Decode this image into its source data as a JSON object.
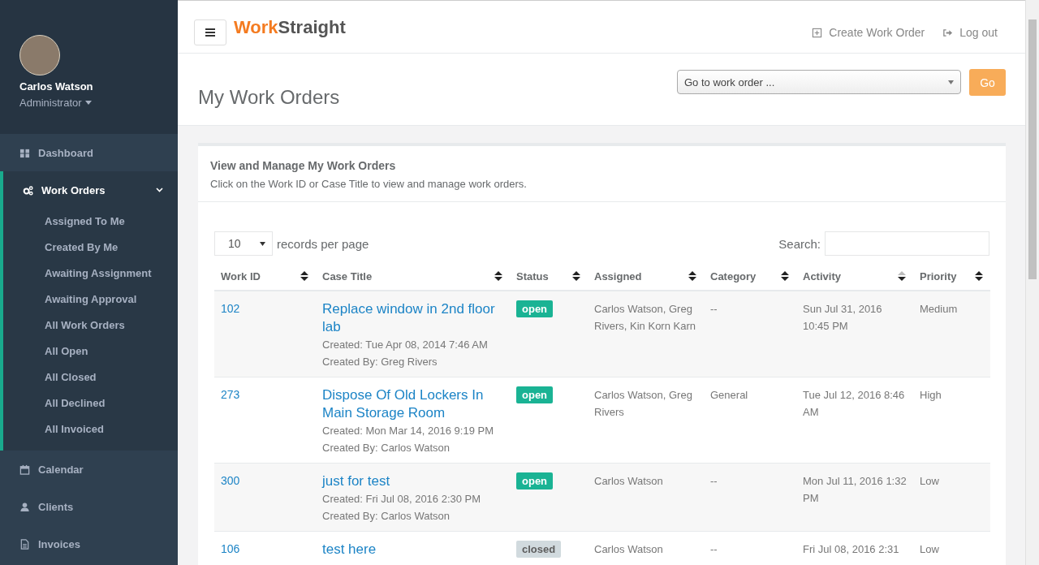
{
  "sidebar": {
    "user": {
      "name": "Carlos Watson",
      "role": "Administrator"
    },
    "items": [
      {
        "label": "Dashboard",
        "expanded": false
      },
      {
        "label": "Work Orders",
        "expanded": true,
        "children": [
          {
            "label": "Assigned To Me"
          },
          {
            "label": "Created By Me"
          },
          {
            "label": "Awaiting Assignment"
          },
          {
            "label": "Awaiting Approval"
          },
          {
            "label": "All Work Orders"
          },
          {
            "label": "All Open"
          },
          {
            "label": "All Closed"
          },
          {
            "label": "All Declined"
          },
          {
            "label": "All Invoiced"
          }
        ]
      },
      {
        "label": "Calendar",
        "expanded": false
      },
      {
        "label": "Clients",
        "expanded": false
      },
      {
        "label": "Invoices",
        "expanded": false
      }
    ]
  },
  "header": {
    "logo_first": "Work",
    "logo_second": "Straight",
    "links": [
      {
        "label": "Create Work Order"
      },
      {
        "label": "Log out"
      }
    ]
  },
  "page": {
    "title": "My Work Orders",
    "goto_placeholder": "Go to work order ...",
    "go_button": "Go"
  },
  "card": {
    "title": "View and Manage My Work Orders",
    "subtitle": "Click on the Work ID or Case Title to view and manage work orders.",
    "page_size": "10",
    "page_size_label": "records per page",
    "search_label": "Search:",
    "columns": [
      {
        "label": "Work ID",
        "sorted": false
      },
      {
        "label": "Case Title",
        "sorted": false
      },
      {
        "label": "Status",
        "sorted": false
      },
      {
        "label": "Assigned",
        "sorted": false
      },
      {
        "label": "Category",
        "sorted": false
      },
      {
        "label": "Activity",
        "sorted": true
      },
      {
        "label": "Priority",
        "sorted": false
      }
    ],
    "rows": [
      {
        "id": "102",
        "title": "Replace window in 2nd floor lab",
        "created": "Created:  Tue Apr 08, 2014 7:46 AM",
        "created_by": "Created By:  Greg Rivers",
        "status": {
          "text": "open",
          "color": "#1ab394"
        },
        "assigned": "Carlos Watson,  Greg Rivers,  Kin Korn Karn",
        "category": "--",
        "activity": "Sun Jul 31, 2016 10:45 PM",
        "priority": "Medium"
      },
      {
        "id": "273",
        "title": "Dispose Of Old Lockers In Main Storage Room",
        "created": "Created:  Mon Mar 14, 2016 9:19 PM",
        "created_by": "Created By:  Carlos Watson",
        "status": {
          "text": "open",
          "color": "#1ab394"
        },
        "assigned": "Carlos Watson,  Greg Rivers",
        "category": "General",
        "activity": "Tue Jul 12, 2016 8:46 AM",
        "priority": "High"
      },
      {
        "id": "300",
        "title": "just for test",
        "created": "Created:  Fri Jul 08, 2016 2:30 PM",
        "created_by": "Created By:  Carlos Watson",
        "status": {
          "text": "open",
          "color": "#1ab394"
        },
        "assigned": "Carlos Watson",
        "category": "--",
        "activity": "Mon Jul 11, 2016 1:32 PM",
        "priority": "Low"
      },
      {
        "id": "106",
        "title": "test here",
        "status": {
          "text": "closed",
          "color": "#d1dade"
        },
        "assigned": "Carlos Watson",
        "category": "--",
        "activity": "Fri Jul 08, 2016 2:31",
        "priority": "Low"
      }
    ]
  }
}
